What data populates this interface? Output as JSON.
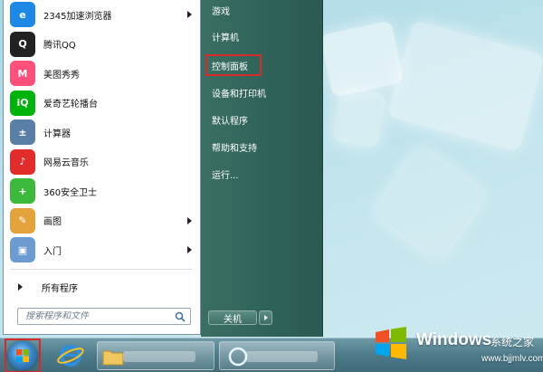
{
  "start_menu": {
    "programs": [
      {
        "label": "2345加速浏览器",
        "icon": "browser-2345-icon",
        "color": "#1e88e5",
        "glyph": "e",
        "has_submenu": true
      },
      {
        "label": "腾讯QQ",
        "icon": "qq-penguin-icon",
        "color": "#222222",
        "glyph": "Q",
        "has_submenu": false
      },
      {
        "label": "美图秀秀",
        "icon": "meitu-icon",
        "color": "#ff4f7b",
        "glyph": "M",
        "has_submenu": false
      },
      {
        "label": "爱奇艺轮播台",
        "icon": "iqiyi-icon",
        "color": "#00b30c",
        "glyph": "iQ",
        "has_submenu": false
      },
      {
        "label": "计算器",
        "icon": "calculator-icon",
        "color": "#5a7fa6",
        "glyph": "±",
        "has_submenu": false
      },
      {
        "label": "网易云音乐",
        "icon": "netease-music-icon",
        "color": "#e22b2b",
        "glyph": "♪",
        "has_submenu": false
      },
      {
        "label": "360安全卫士",
        "icon": "360-security-icon",
        "color": "#3cb93c",
        "glyph": "+",
        "has_submenu": false
      },
      {
        "label": "画图",
        "icon": "paint-icon",
        "color": "#e3a23b",
        "glyph": "✎",
        "has_submenu": true
      },
      {
        "label": "入门",
        "icon": "getting-started-icon",
        "color": "#6c9bd2",
        "glyph": "▣",
        "has_submenu": true
      }
    ],
    "all_programs_label": "所有程序",
    "search_placeholder": "搜索程序和文件",
    "right_items": [
      {
        "label": "游戏",
        "name": "right-item-games",
        "highlight": false
      },
      {
        "label": "计算机",
        "name": "right-item-computer",
        "highlight": false
      },
      {
        "label": "控制面板",
        "name": "right-item-control-panel",
        "highlight": true
      },
      {
        "label": "设备和打印机",
        "name": "right-item-devices-printers",
        "highlight": false
      },
      {
        "label": "默认程序",
        "name": "right-item-default-programs",
        "highlight": false
      },
      {
        "label": "帮助和支持",
        "name": "right-item-help-support",
        "highlight": false
      },
      {
        "label": "运行...",
        "name": "right-item-run",
        "highlight": false
      }
    ],
    "shutdown_label": "关机",
    "highlight_color": "#d72b2b"
  },
  "watermark": {
    "brand": "Windows",
    "site_name": "系统之家",
    "url": "www.bjjmlv.com"
  }
}
